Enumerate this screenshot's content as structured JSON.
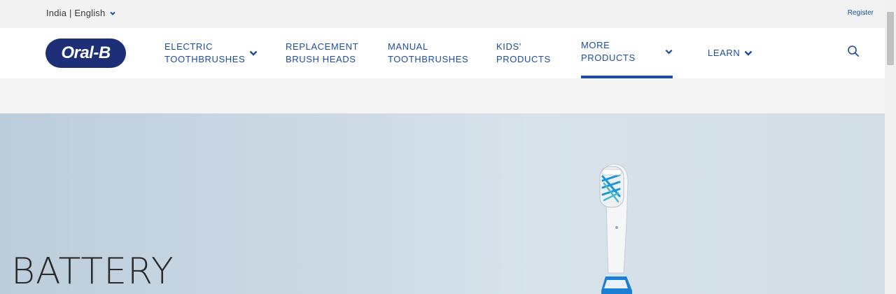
{
  "topbar": {
    "locale": "India | English",
    "register": "Register"
  },
  "brand": {
    "logo_text": "Oral-B",
    "primary_color": "#1c4da1",
    "logo_color": "#1c2f77"
  },
  "nav": {
    "items": [
      {
        "label": "ELECTRIC\nTOOTHBRUSHES",
        "has_dropdown": true
      },
      {
        "label": "REPLACEMENT\nBRUSH HEADS",
        "has_dropdown": false
      },
      {
        "label": "MANUAL\nTOOTHBRUSHES",
        "has_dropdown": false
      },
      {
        "label": "KIDS'\nPRODUCTS",
        "has_dropdown": false
      },
      {
        "label": "MORE PRODUCTS",
        "has_dropdown": true,
        "active": true
      },
      {
        "label": "LEARN",
        "has_dropdown": true
      }
    ],
    "search_icon": "search-icon"
  },
  "hero": {
    "title": "BATTERY"
  }
}
